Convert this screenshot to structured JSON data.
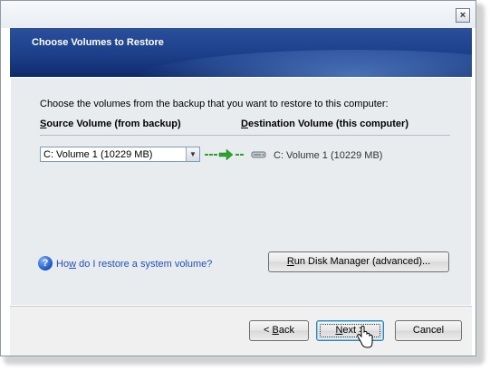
{
  "window": {
    "close_glyph": "×"
  },
  "banner": {
    "title": "Choose Volumes to Restore"
  },
  "instructions": "Choose the volumes from the backup that you want to restore to this computer:",
  "columns": {
    "source_first": "S",
    "source_rest": "ource Volume (from backup)",
    "dest_first": "D",
    "dest_rest": "estination Volume (this computer)"
  },
  "source_select": {
    "value": "C: Volume 1 (10229 MB)",
    "arrow_glyph": "▼"
  },
  "destination": {
    "value": "C: Volume 1 (10229 MB)"
  },
  "help": {
    "icon_glyph": "?",
    "link_first": "Ho",
    "link_underlined": "w",
    "link_rest": " do I restore a system volume?"
  },
  "buttons": {
    "disk_manager_first": "R",
    "disk_manager_rest": "un Disk Manager (advanced)...",
    "back_prefix": "< ",
    "back_underlined": "B",
    "back_rest": "ack",
    "next_underlined": "N",
    "next_rest": "ext >",
    "cancel": "Cancel"
  },
  "colors": {
    "banner": "#1d3f8a",
    "link": "#1f4fbf",
    "arrow": "#2aa52a"
  },
  "icons": {
    "arrow": "green-arrow-icon",
    "disk": "hard-disk-icon",
    "help": "help-icon",
    "cursor": "mouse-pointer-icon"
  }
}
